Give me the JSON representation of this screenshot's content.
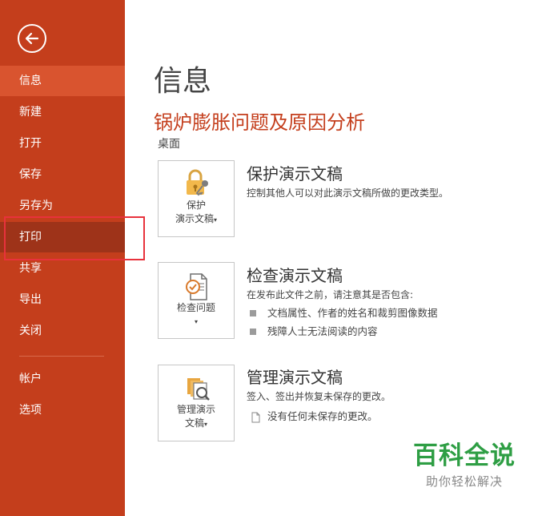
{
  "sidebar": {
    "items": [
      {
        "label": "信息"
      },
      {
        "label": "新建"
      },
      {
        "label": "打开"
      },
      {
        "label": "保存"
      },
      {
        "label": "另存为"
      },
      {
        "label": "打印"
      },
      {
        "label": "共享"
      },
      {
        "label": "导出"
      },
      {
        "label": "关闭"
      },
      {
        "label": "帐户"
      },
      {
        "label": "选项"
      }
    ],
    "selected": "信息",
    "highlighted": "打印"
  },
  "main": {
    "page_title": "信息",
    "doc_title": "锅炉膨胀问题及原因分析",
    "doc_location": "桌面",
    "sections": [
      {
        "button": {
          "line1": "保护",
          "line2": "演示文稿",
          "icon": "lock-key-icon"
        },
        "heading": "保护演示文稿",
        "description": "控制其他人可以对此演示文稿所做的更改类型。"
      },
      {
        "button": {
          "line1": "检查问题",
          "icon": "inspect-document-icon"
        },
        "heading": "检查演示文稿",
        "description": "在发布此文件之前，请注意其是否包含:",
        "bullets": [
          "文档属性、作者的姓名和裁剪图像数据",
          "残障人士无法阅读的内容"
        ]
      },
      {
        "button": {
          "line1": "管理演示",
          "line2": "文稿",
          "icon": "manage-versions-icon"
        },
        "heading": "管理演示文稿",
        "description": "签入、签出并恢复未保存的更改。",
        "note": "没有任何未保存的更改。"
      }
    ]
  },
  "watermark": {
    "title": "百科全说",
    "subtitle": "助你轻松解决"
  },
  "colors": {
    "sidebar": "#c43e1c",
    "selected": "#d9542f",
    "hover": "#9e3319",
    "highlight_box": "#e8323c",
    "watermark_green": "#2e9e44"
  }
}
